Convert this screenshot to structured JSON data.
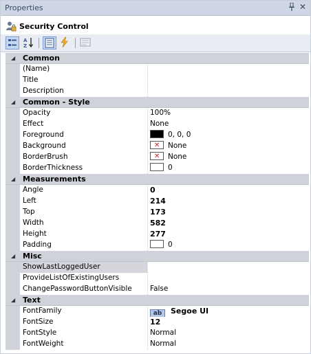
{
  "panel": {
    "title": "Properties",
    "pin_icon": "pin-icon",
    "close_icon": "close-icon"
  },
  "selection": {
    "icon": "security-control-icon",
    "label": "Security Control"
  },
  "toolbar": {
    "buttons": [
      {
        "icon": "categorized-icon",
        "active": true
      },
      {
        "icon": "sort-alphabetical-icon",
        "active": false
      },
      {
        "icon": "properties-icon",
        "active": true
      },
      {
        "icon": "events-lightning-icon",
        "active": false
      },
      {
        "icon": "property-pages-icon",
        "active": false
      }
    ]
  },
  "categories": {
    "common": "Common",
    "common_style": "Common - Style",
    "measurements": "Measurements",
    "misc": "Misc",
    "text": "Text"
  },
  "rows": {
    "name": {
      "name": "(Name)",
      "value": ""
    },
    "title": {
      "name": "Title",
      "value": ""
    },
    "description": {
      "name": "Description",
      "value": ""
    },
    "opacity": {
      "name": "Opacity",
      "value": "100%"
    },
    "effect": {
      "name": "Effect",
      "value": "None"
    },
    "foreground": {
      "name": "Foreground",
      "value": "0, 0, 0"
    },
    "background": {
      "name": "Background",
      "value": "None"
    },
    "borderbrush": {
      "name": "BorderBrush",
      "value": "None"
    },
    "borderthickness": {
      "name": "BorderThickness",
      "value": "0"
    },
    "angle": {
      "name": "Angle",
      "value": "0"
    },
    "left": {
      "name": "Left",
      "value": "214"
    },
    "top": {
      "name": "Top",
      "value": "173"
    },
    "width": {
      "name": "Width",
      "value": "582"
    },
    "height": {
      "name": "Height",
      "value": "277"
    },
    "padding": {
      "name": "Padding",
      "value": "0"
    },
    "showlastloggeduser": {
      "name": "ShowLastLoggedUser",
      "value": ""
    },
    "providelist": {
      "name": "ProvideListOfExistingUsers",
      "value": ""
    },
    "changepassword": {
      "name": "ChangePasswordButtonVisible",
      "value": "False"
    },
    "fontfamily": {
      "name": "FontFamily",
      "value": "Segoe UI",
      "chip": "ab"
    },
    "fontsize": {
      "name": "FontSize",
      "value": "12"
    },
    "fontstyle": {
      "name": "FontStyle",
      "value": "Normal"
    },
    "fontweight": {
      "name": "FontWeight",
      "value": "Normal"
    }
  },
  "colors": {
    "foreground_swatch": "#000000",
    "none_mark": "#c62828",
    "category_bg": "#cfd2d8",
    "titlebar_bg": "#cfd6e5"
  }
}
